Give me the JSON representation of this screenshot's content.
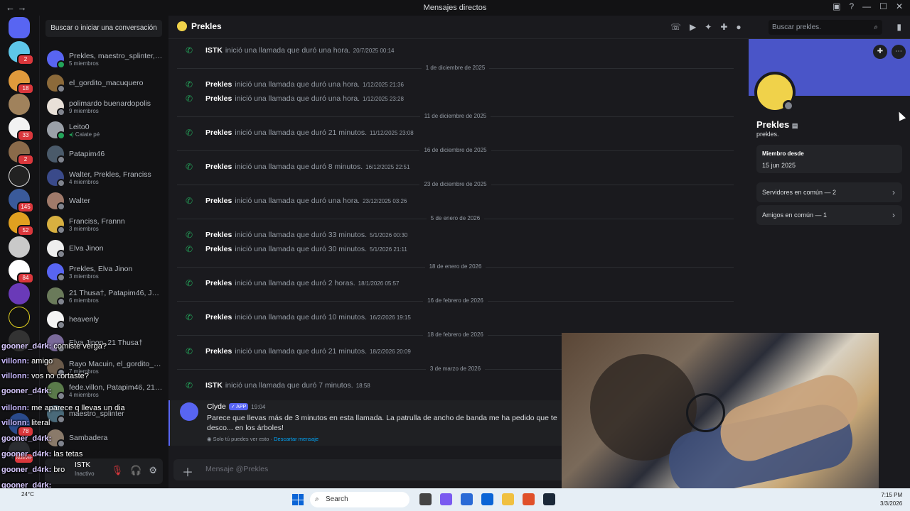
{
  "window": {
    "title": "Mensajes directos"
  },
  "dm_sidebar": {
    "search_label": "Buscar o iniciar una conversación",
    "items": [
      {
        "name": "Prekles, maestro_splinter, ...",
        "sub": "5 miembros"
      },
      {
        "name": "el_gordito_macuquero",
        "sub": ""
      },
      {
        "name": "polimardo buenardopolis",
        "sub": "9 miembros"
      },
      {
        "name": "Leito0",
        "sub": "Caiate pé"
      },
      {
        "name": "Patapim46",
        "sub": ""
      },
      {
        "name": "Walter, Prekles, Franciss",
        "sub": "4 miembros"
      },
      {
        "name": "Walter",
        "sub": ""
      },
      {
        "name": "Franciss, Frannn",
        "sub": "3 miembros"
      },
      {
        "name": "Elva Jinon",
        "sub": ""
      },
      {
        "name": "Prekles, Elva Jinon",
        "sub": "3 miembros"
      },
      {
        "name": "21 Thusa†, Patapim46, Jua...",
        "sub": "6 miembros"
      },
      {
        "name": "heavenly",
        "sub": ""
      },
      {
        "name": "Elva Jinon, 21 Thusa†",
        "sub": ""
      },
      {
        "name": "Rayo Macuin, el_gordito_m...",
        "sub": "7 miembros"
      },
      {
        "name": "fede.villon, Patapim46, 21 ...",
        "sub": "4 miembros"
      },
      {
        "name": "maestro_splinter",
        "sub": ""
      },
      {
        "name": "Sambadera",
        "sub": ""
      }
    ],
    "user_panel": {
      "name": "ISTK",
      "status": "Inactivo"
    }
  },
  "guild_badges": [
    "2",
    "18",
    "33",
    "2",
    "145",
    "52",
    "84",
    "78",
    "NUEVO"
  ],
  "header": {
    "recipient": "Prekles",
    "search_placeholder": "Buscar prekles."
  },
  "messages": [
    {
      "type": "call",
      "author": "ISTK",
      "text": "inició una llamada que duró una hora.",
      "time": "20/7/2025 00:14"
    },
    {
      "type": "divider",
      "label": "1 de diciembre de 2025"
    },
    {
      "type": "call",
      "author": "Prekles",
      "text": "inició una llamada que duró una hora.",
      "time": "1/12/2025 21:36"
    },
    {
      "type": "call",
      "author": "Prekles",
      "text": "inició una llamada que duró una hora.",
      "time": "1/12/2025 23:28"
    },
    {
      "type": "divider",
      "label": "11 de diciembre de 2025"
    },
    {
      "type": "call",
      "author": "Prekles",
      "text": "inició una llamada que duró 21 minutos.",
      "time": "11/12/2025 23:08"
    },
    {
      "type": "divider",
      "label": "16 de diciembre de 2025"
    },
    {
      "type": "call",
      "author": "Prekles",
      "text": "inició una llamada que duró 8 minutos.",
      "time": "16/12/2025 22:51"
    },
    {
      "type": "divider",
      "label": "23 de diciembre de 2025"
    },
    {
      "type": "call",
      "author": "Prekles",
      "text": "inició una llamada que duró una hora.",
      "time": "23/12/2025 03:26"
    },
    {
      "type": "divider",
      "label": "5 de enero de 2026"
    },
    {
      "type": "call",
      "author": "Prekles",
      "text": "inició una llamada que duró 33 minutos.",
      "time": "5/1/2026 00:30"
    },
    {
      "type": "call",
      "author": "Prekles",
      "text": "inició una llamada que duró 30 minutos.",
      "time": "5/1/2026 21:11"
    },
    {
      "type": "divider",
      "label": "18 de enero de 2026"
    },
    {
      "type": "call",
      "author": "Prekles",
      "text": "inició una llamada que duró 2 horas.",
      "time": "18/1/2026 05:57"
    },
    {
      "type": "divider",
      "label": "16 de febrero de 2026"
    },
    {
      "type": "call",
      "author": "Prekles",
      "text": "inició una llamada que duró 10 minutos.",
      "time": "16/2/2026 19:15"
    },
    {
      "type": "divider",
      "label": "18 de febrero de 2026"
    },
    {
      "type": "call",
      "author": "Prekles",
      "text": "inició una llamada que duró 21 minutos.",
      "time": "18/2/2026 20:09"
    },
    {
      "type": "divider",
      "label": "3 de marzo de 2026"
    },
    {
      "type": "call",
      "author": "ISTK",
      "text": "inició una llamada que duró 7 minutos.",
      "time": "18:58"
    }
  ],
  "clyde": {
    "name": "Clyde",
    "tag": "✓ APP",
    "time": "19:04",
    "text": "Parece que llevas más de 3 minutos en esta llamada. La patrulla de ancho de banda me ha pedido que te desco... en los árboles!",
    "ephemeral": "Solo tú puedes ver esto ·",
    "dismiss": "Descartar mensaje"
  },
  "composer": {
    "placeholder": "Mensaje @Prekles"
  },
  "profile": {
    "display_name": "Prekles",
    "username": "prekles.",
    "member_since_label": "Miembro desde",
    "member_since": "15 jun 2025",
    "mutual_servers": "Servidores en común — 2",
    "mutual_friends": "Amigos en común — 1"
  },
  "stream_chat": [
    {
      "user": "gooner_d4rk:",
      "msg": "comiste verga?"
    },
    {
      "user": "villonn:",
      "msg": "amigo"
    },
    {
      "user": "villonn:",
      "msg": "vos no cortaste?"
    },
    {
      "user": "gooner_d4rk:",
      "msg": ""
    },
    {
      "user": "villonn:",
      "msg": "me aparece q llevas un dia"
    },
    {
      "user": "villonn:",
      "msg": "literal"
    },
    {
      "user": "gooner_d4rk:",
      "msg": ""
    },
    {
      "user": "gooner_d4rk:",
      "msg": "las tetas"
    },
    {
      "user": "gooner_d4rk:",
      "msg": "bro"
    },
    {
      "user": "gooner_d4rk:",
      "msg": ""
    },
    {
      "user": "gooner_d4rk",
      "msg": ""
    }
  ],
  "taskbar": {
    "weather": "24°C",
    "search": "Search",
    "time": "7:15 PM",
    "date": "3/3/2026"
  }
}
